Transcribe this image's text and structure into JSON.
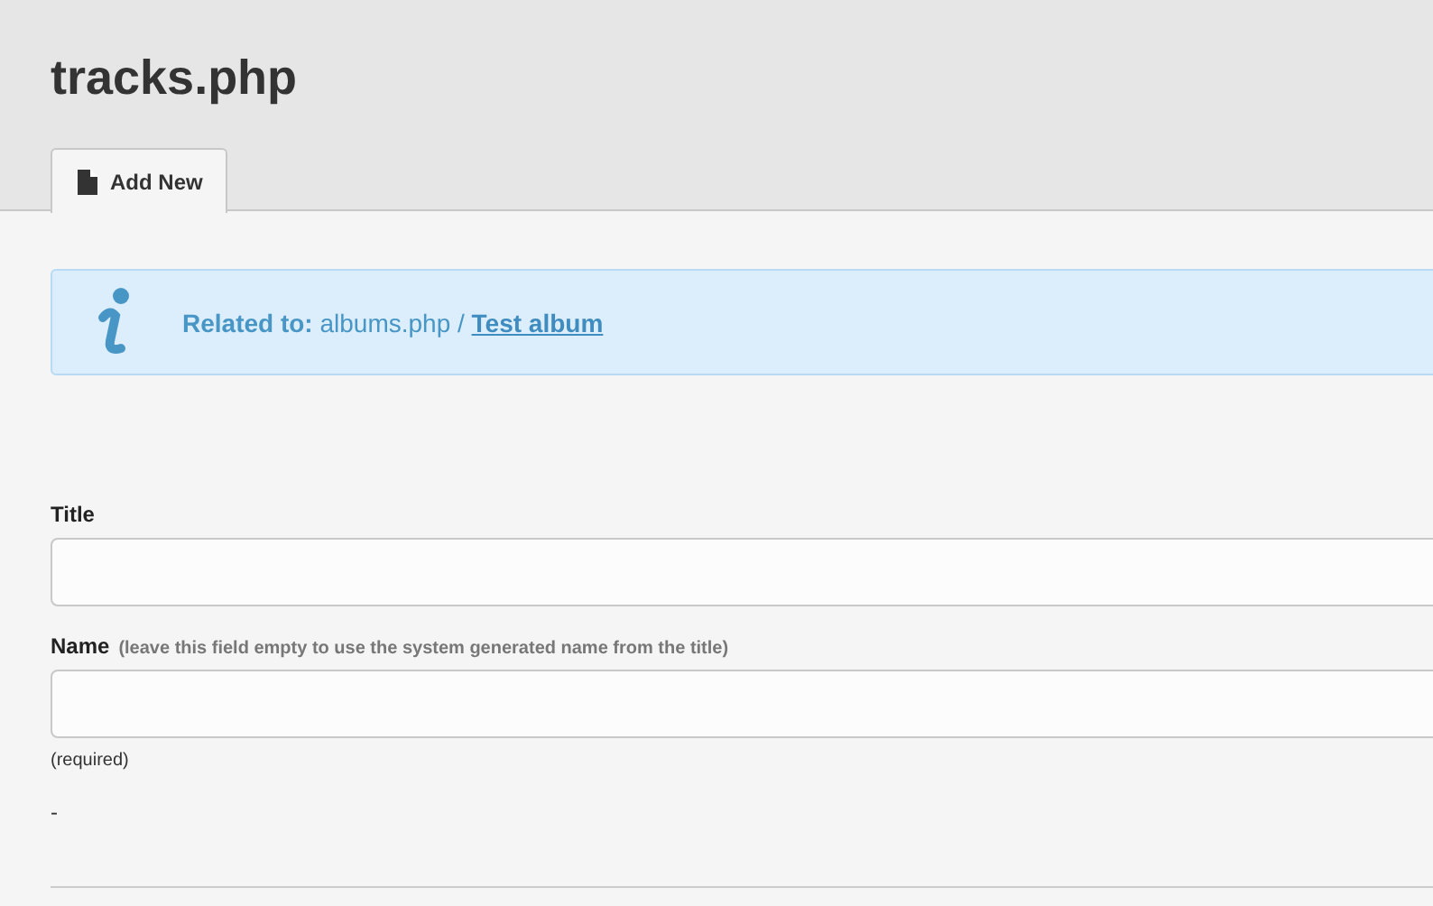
{
  "page_title": "tracks.php",
  "tabs": [
    {
      "label": "Add New",
      "selected": true
    }
  ],
  "info": {
    "label": "Related to:",
    "parent": "albums.php /",
    "link": "Test album"
  },
  "fields": [
    {
      "label": "Title"
    },
    {
      "label": "Name",
      "hint": "(leave this field empty to use the system generated name from the title)",
      "note": "(required)"
    }
  ],
  "trailing_text": "-"
}
